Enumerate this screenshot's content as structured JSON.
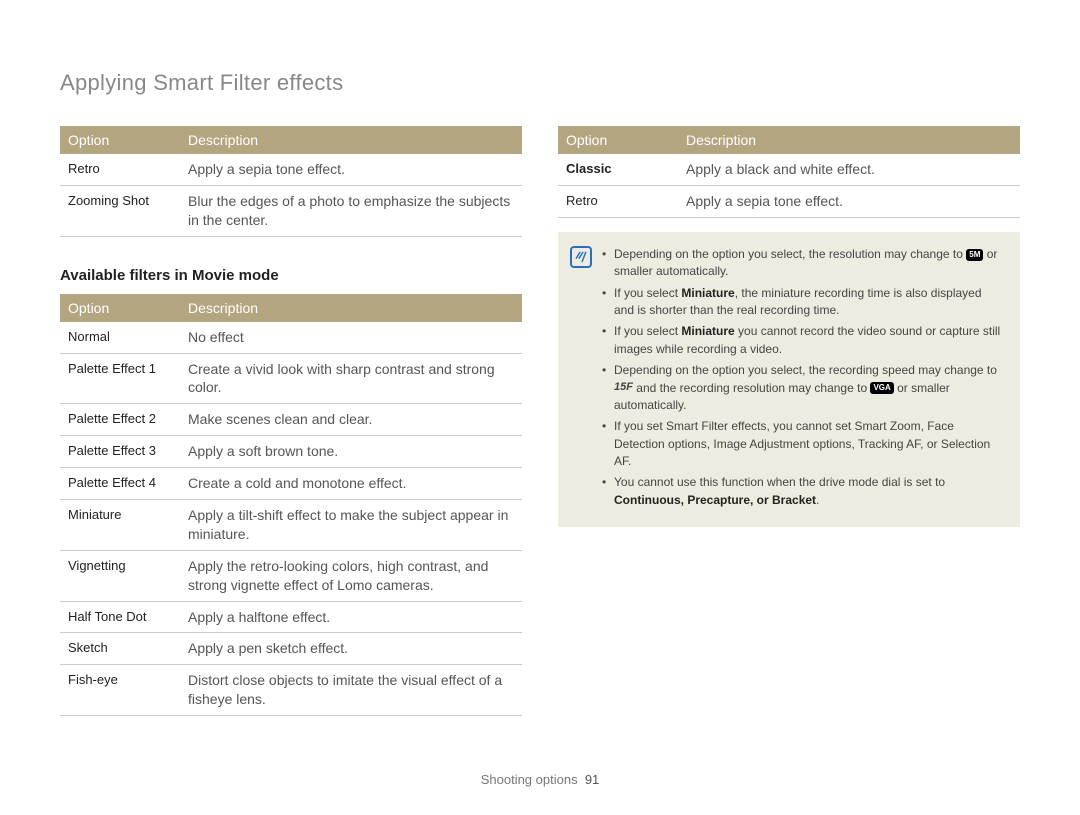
{
  "title": "Applying Smart Filter effects",
  "headers": {
    "option": "Option",
    "description": "Description"
  },
  "table_top_left": [
    {
      "option": "Retro",
      "desc": "Apply a sepia tone effect."
    },
    {
      "option": "Zooming Shot",
      "desc": "Blur the edges of a photo to emphasize the subjects in the center."
    }
  ],
  "movie_heading": "Available filters in Movie mode",
  "table_movie": [
    {
      "option": "Normal",
      "desc": "No effect"
    },
    {
      "option": "Palette Effect 1",
      "desc": "Create a vivid look with sharp contrast and strong color."
    },
    {
      "option": "Palette Effect 2",
      "desc": "Make scenes clean and clear."
    },
    {
      "option": "Palette Effect 3",
      "desc": "Apply a soft brown tone."
    },
    {
      "option": "Palette Effect 4",
      "desc": "Create a cold and monotone effect."
    },
    {
      "option": "Miniature",
      "desc": "Apply a tilt-shift effect to make the subject appear in miniature."
    },
    {
      "option": "Vignetting",
      "desc": "Apply the retro-looking colors, high contrast, and strong vignette effect of Lomo cameras."
    },
    {
      "option": "Half Tone Dot",
      "desc": "Apply a halftone effect."
    },
    {
      "option": "Sketch",
      "desc": "Apply a pen sketch effect."
    },
    {
      "option": "Fish-eye",
      "desc": "Distort close objects to imitate the visual effect of a fisheye lens."
    }
  ],
  "table_top_right": [
    {
      "option": "Classic",
      "option_bold": true,
      "desc": "Apply a black and white effect."
    },
    {
      "option": "Retro",
      "desc": "Apply a sepia tone effect."
    }
  ],
  "notes": {
    "n1a": "Depending on the option you select, the resolution may change to ",
    "n1_badge": "5M",
    "n1b": " or smaller automatically.",
    "n2a": "If you select ",
    "n2_bold": "Miniature",
    "n2b": ", the miniature recording time is also displayed and is shorter than the real recording time.",
    "n3a": "If you select ",
    "n3_bold": "Miniature",
    "n3b": " you cannot record the video sound or capture still images while recording a video.",
    "n4a": "Depending on the option you select, the recording speed may change to ",
    "n4_fps": "15F",
    "n4b": " and the recording resolution may change to ",
    "n4_badge": "VGA",
    "n4c": " or smaller automatically.",
    "n5": "If you set Smart Filter effects, you cannot set Smart Zoom, Face Detection options, Image Adjustment options, Tracking AF, or Selection AF.",
    "n6a": "You cannot use this function when the drive mode dial is set to ",
    "n6_bold": "Continuous, Precapture, or Bracket"
  },
  "footer": {
    "section": "Shooting options",
    "page": "91"
  }
}
